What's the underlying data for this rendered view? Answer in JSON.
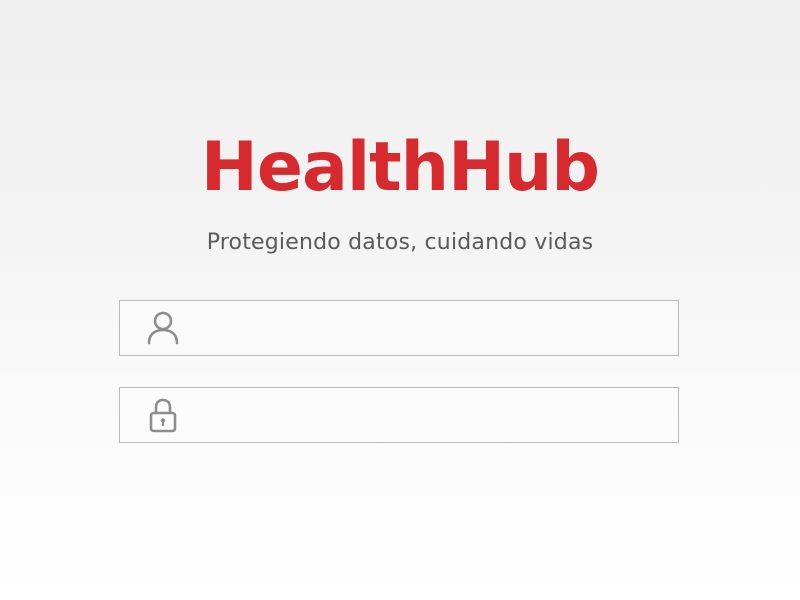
{
  "app": {
    "title": "HealthHub",
    "tagline": "Protegiendo datos, cuidando vidas",
    "accent_color": "#d72a2f"
  },
  "form": {
    "username": {
      "icon": "user-icon",
      "value": "",
      "placeholder": ""
    },
    "password": {
      "icon": "lock-icon",
      "value": "",
      "placeholder": ""
    }
  }
}
